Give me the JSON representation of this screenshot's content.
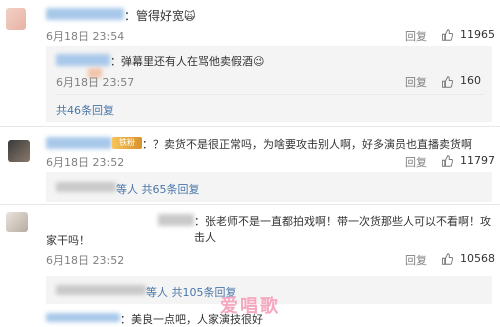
{
  "comments": [
    {
      "text": "：管得好宽",
      "emoji": "🙀",
      "time": "6月18日 23:54",
      "reply": "回复",
      "like_count": "11965",
      "sub": {
        "text": "：弹幕里还有人在骂他卖假酒",
        "emoji": "😉",
        "time": "6月18日 23:57",
        "reply": "回复",
        "like_count": "160"
      },
      "more_link": "共46条回复"
    },
    {
      "badge": "铁粉",
      "text": "：？卖货不是很正常吗，为啥要攻击别人啊，好多演员也直播卖货啊",
      "time": "6月18日 23:52",
      "reply": "回复",
      "like_count": "11797",
      "more_link": "等人 共65条回复"
    },
    {
      "text_line1": "：张老师不是一直都拍戏啊！带一次货那些人可以不看啊！攻击人",
      "text_line2": "家干吗！",
      "time": "6月18日 23:52",
      "reply": "回复",
      "like_count": "10568",
      "more_link": "等人 共105条回复"
    },
    {
      "text_partial": "：美良一点吧，人家演技很好"
    }
  ],
  "watermark": "爱唱歌"
}
